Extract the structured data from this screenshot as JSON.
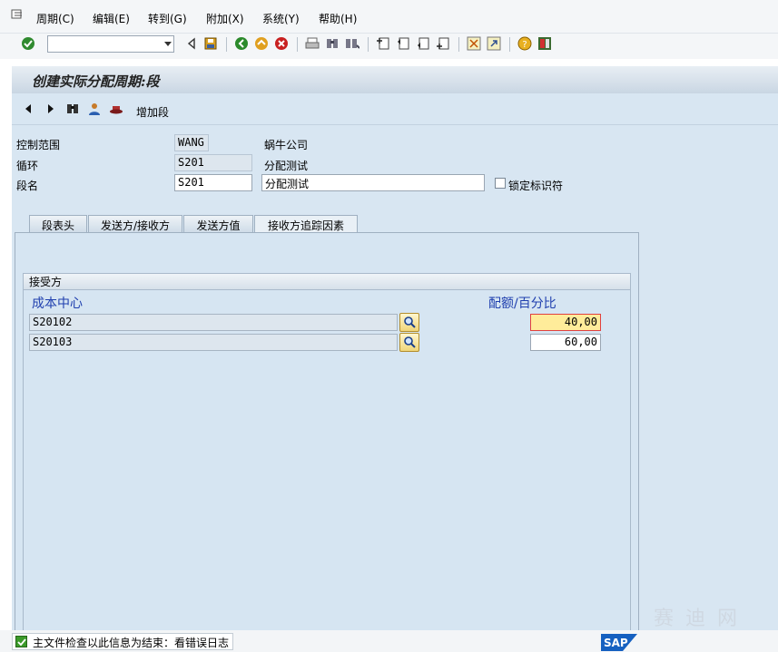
{
  "menu": {
    "items": [
      {
        "label": "周期(C)"
      },
      {
        "label": "编辑(E)"
      },
      {
        "label": "转到(G)"
      },
      {
        "label": "附加(X)"
      },
      {
        "label": "系统(Y)"
      },
      {
        "label": "帮助(H)"
      }
    ]
  },
  "toolbar": {
    "command_value": "",
    "icons": [
      "enter-icon",
      "back-triangle-icon",
      "save-icon",
      "back-icon",
      "exit-icon",
      "cancel-icon",
      "print-icon",
      "find-icon",
      "find-next-icon",
      "first-page-icon",
      "prev-page-icon",
      "next-page-icon",
      "last-page-icon",
      "new-session-icon",
      "shortcut-icon",
      "help-icon",
      "layout-icon"
    ]
  },
  "header": {
    "title": "创建实际分配周期:段",
    "add_segment": "增加段"
  },
  "form": {
    "controlling_area_label": "控制范围",
    "controlling_area_value": "WANG",
    "controlling_area_desc": "蜗牛公司",
    "cycle_label": "循环",
    "cycle_value": "S201",
    "cycle_desc": "分配测试",
    "segment_label": "段名",
    "segment_value": "S201",
    "segment_desc": "分配测试",
    "lock_label": "锁定标识符"
  },
  "tabs": [
    {
      "label": "段表头"
    },
    {
      "label": "发送方/接收方"
    },
    {
      "label": "发送方值"
    },
    {
      "label": "接收方追踪因素"
    }
  ],
  "receiver": {
    "group_title": "接受方",
    "col_cost_center": "成本中心",
    "col_share": "配额/百分比",
    "rows": [
      {
        "cost_center": "S20102",
        "share": "40,00"
      },
      {
        "cost_center": "S20103",
        "share": "60,00"
      }
    ]
  },
  "status": {
    "message": "主文件检查以此信息为结束：看错误日志"
  },
  "branding": {
    "logo_text": "SAP",
    "watermark": "赛 迪 网"
  },
  "colors": {
    "accent_blue": "#1f3fae",
    "panel_bg": "#d8e6f2",
    "focus_yellow": "#ffec9a"
  }
}
